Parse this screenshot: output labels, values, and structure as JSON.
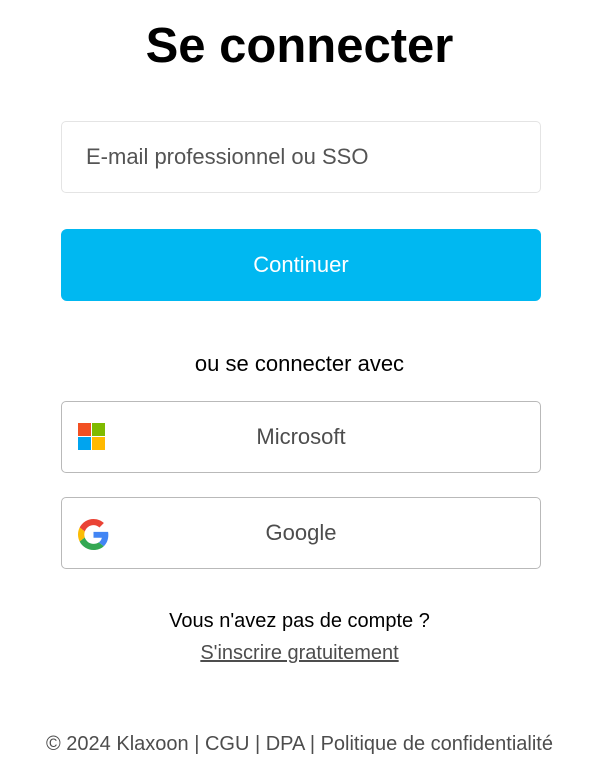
{
  "page": {
    "title": "Se connecter"
  },
  "email": {
    "placeholder": "E-mail professionnel ou SSO",
    "value": ""
  },
  "continue_button": {
    "label": "Continuer",
    "color": "#00b8f1"
  },
  "alternatives": {
    "label": "ou se connecter avec",
    "providers": [
      {
        "label": "Microsoft",
        "icon": "microsoft-logo-icon"
      },
      {
        "label": "Google",
        "icon": "google-logo-icon"
      }
    ]
  },
  "signup": {
    "question": "Vous n'avez pas de compte ?",
    "link_label": "S'inscrire gratuitement"
  },
  "footer": {
    "copyright": "© 2024 Klaxoon",
    "separator": " | ",
    "links": [
      "CGU",
      "DPA",
      "Politique de confidentialité"
    ]
  }
}
